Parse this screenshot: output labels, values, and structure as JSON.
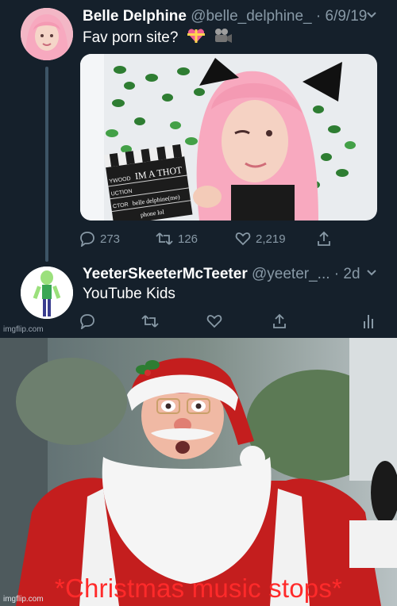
{
  "tweet1": {
    "display_name": "Belle Delphine",
    "handle_date": "@belle_delphine_ · 6/9/19",
    "text": "Fav porn site?",
    "media_caption": {
      "slate_line1": "IM A THOT",
      "slate_line2": "belle delphine(me)",
      "slate_line3": "phone lol",
      "slate_wood": "YWOOD",
      "slate_uction": "UCTION",
      "slate_ctor": "CTOR"
    },
    "stats": {
      "replies": "273",
      "retweets": "126",
      "likes": "2,219"
    }
  },
  "tweet2": {
    "display_name": "YeeterSkeeterMcTeeter",
    "handle_date": "@yeeter_... · 2d",
    "text": "YouTube Kids"
  },
  "watermark": "imgflip.com",
  "meme": {
    "caption": "*Christmas music stops*"
  },
  "icons": [
    "reply-icon",
    "retweet-icon",
    "like-icon",
    "share-icon",
    "analytics-icon",
    "chevron-down-icon",
    "gift-heart-emoji",
    "movie-camera-emoji"
  ],
  "colors": {
    "background": "#15202b",
    "muted": "#8899a6",
    "caption": "#ff2a2a"
  }
}
